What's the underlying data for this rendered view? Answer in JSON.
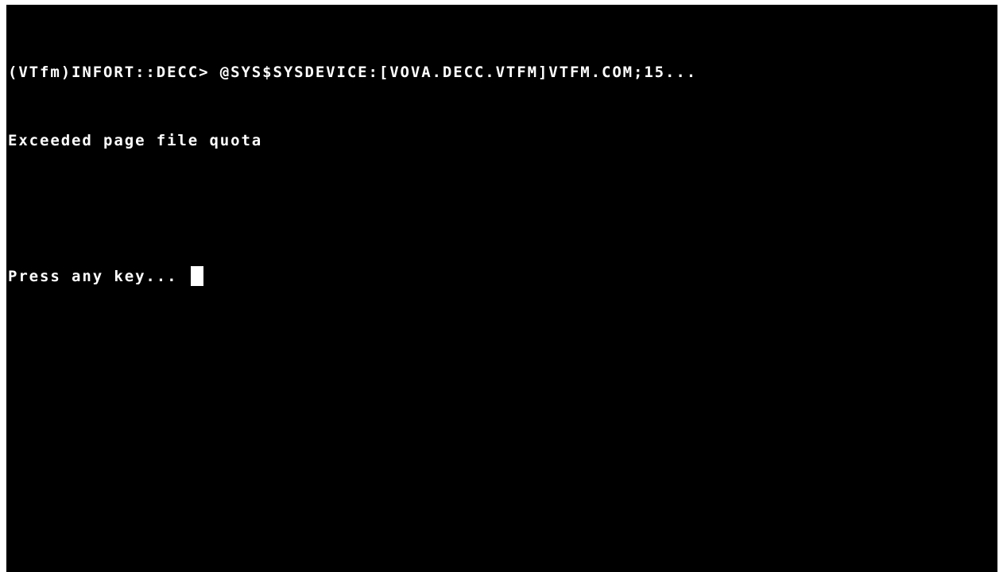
{
  "terminal": {
    "lines": [
      "(VTfm)INFORT::DECC> @SYS$SYSDEVICE:[VOVA.DECC.VTFM]VTFM.COM;15...",
      "Exceeded page file quota",
      ""
    ],
    "prompt": "Press any key... "
  },
  "colors": {
    "background": "#000000",
    "foreground": "#ffffff"
  }
}
